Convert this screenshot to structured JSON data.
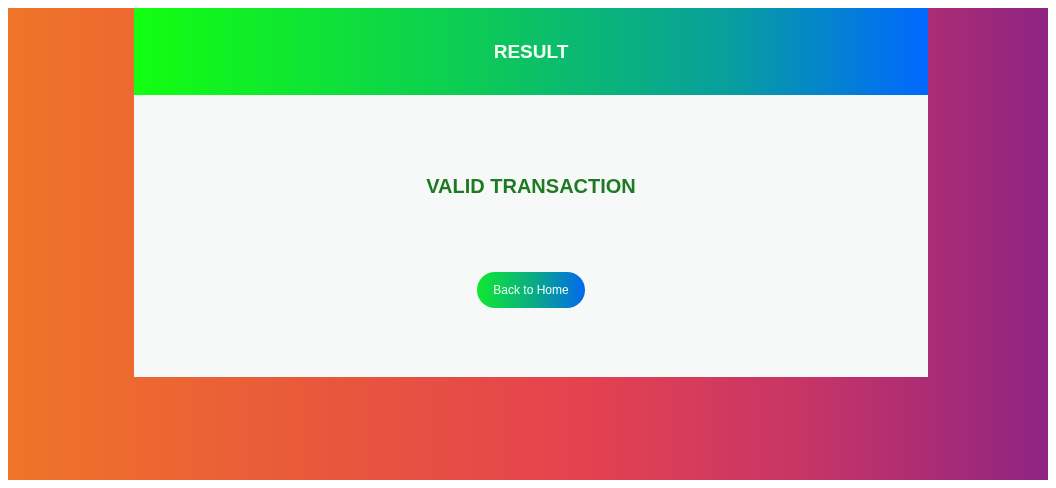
{
  "header": {
    "title": "RESULT"
  },
  "result": {
    "message": "VALID TRANSACTION",
    "kind": "valid"
  },
  "button": {
    "label": "Back to Home"
  }
}
